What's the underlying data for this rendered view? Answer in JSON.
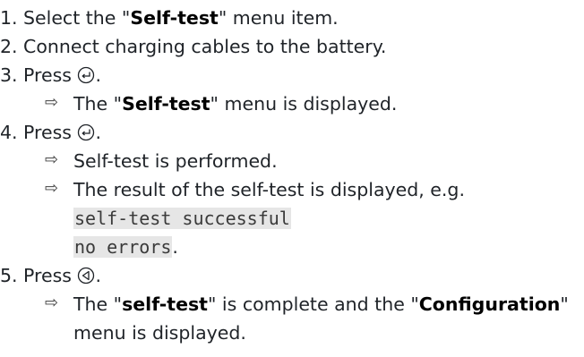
{
  "steps": [
    {
      "num": "1.",
      "pre": "Select the \"",
      "bold": "Self-test",
      "post": "\" menu item."
    },
    {
      "num": "2.",
      "text": "Connect charging cables to the battery."
    },
    {
      "num": "3.",
      "text": "Press",
      "icon": "enter-key-icon",
      "after": "."
    },
    {
      "result": true,
      "pre": "The \"",
      "bold": "Self-test",
      "post": "\" menu is displayed."
    },
    {
      "num": "4.",
      "text": "Press",
      "icon": "enter-key-icon",
      "after": "."
    },
    {
      "result": true,
      "text": "Self-test is performed."
    },
    {
      "result": true,
      "text": "The result of the self-test is displayed, e.g."
    },
    {
      "mono1": "self-test successful"
    },
    {
      "mono2": "no errors",
      "after": "."
    },
    {
      "num": "5.",
      "text": "Press",
      "icon": "back-key-icon",
      "after": "."
    },
    {
      "result": true,
      "pre": "The \"",
      "bold": "self-test",
      "mid": "\" is complete and the \"",
      "bold2": "Configuration",
      "post": "\""
    },
    {
      "cont": "menu is displayed."
    }
  ],
  "arrow_glyph": "⇨"
}
